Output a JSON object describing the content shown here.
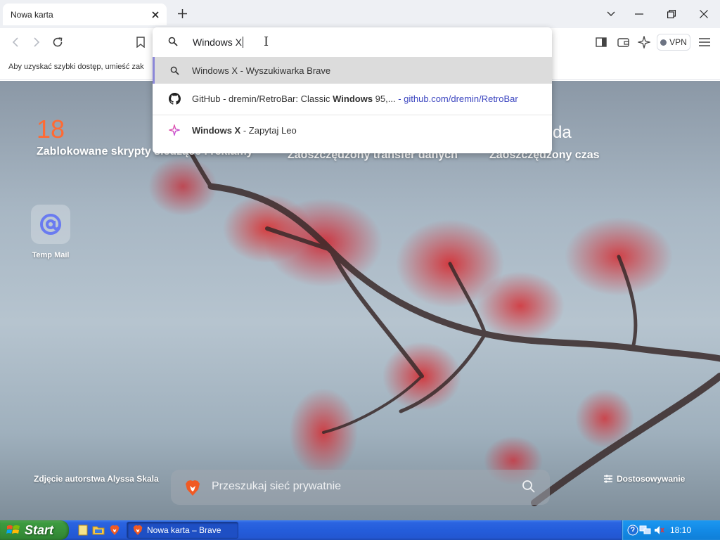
{
  "tab": {
    "title": "Nowa karta"
  },
  "bookmark_bar": {
    "hint": "Aby uzyskać szybki dostęp, umieść zak"
  },
  "toolbar": {
    "vpn_label": "VPN"
  },
  "omnibox": {
    "query": "Windows X",
    "suggestions": [
      {
        "icon": "search-icon",
        "main": "Windows X",
        "suffix": " - Wyszukiwarka Brave"
      },
      {
        "icon": "github-icon",
        "prefix": "GitHub - dremin/RetroBar: Classic ",
        "bold": "Windows",
        "rest": " 95,...",
        "sep": " - ",
        "url": "github.com/dremin/RetroBar"
      },
      {
        "icon": "leo-sparkle-icon",
        "bold": "Windows X",
        "suffix": " - Zapytaj Leo"
      }
    ]
  },
  "ntp": {
    "stats": [
      {
        "value": "18",
        "label": "Zablokowane skrypty śledzące i reklamy"
      },
      {
        "value": "",
        "label": "Zaoszczędzony transfer danych"
      },
      {
        "value": "da",
        "label": "Zaoszczędzony czas"
      }
    ],
    "top_site": {
      "name": "Temp Mail"
    },
    "photo_credit": "Zdjęcie autorstwa Alyssa Skala",
    "search_placeholder": "Przeszukaj sieć prywatnie",
    "customize_label": "Dostosowywanie"
  },
  "taskbar": {
    "start_label": "Start",
    "task_label": "Nowa karta – Brave",
    "clock": "18:10"
  },
  "colors": {
    "accent": "#8b87d8",
    "stat_number": "#ff6a33",
    "url": "#3c46c0",
    "xp_taskbar": "#245ddb",
    "xp_start": "#37913a"
  }
}
